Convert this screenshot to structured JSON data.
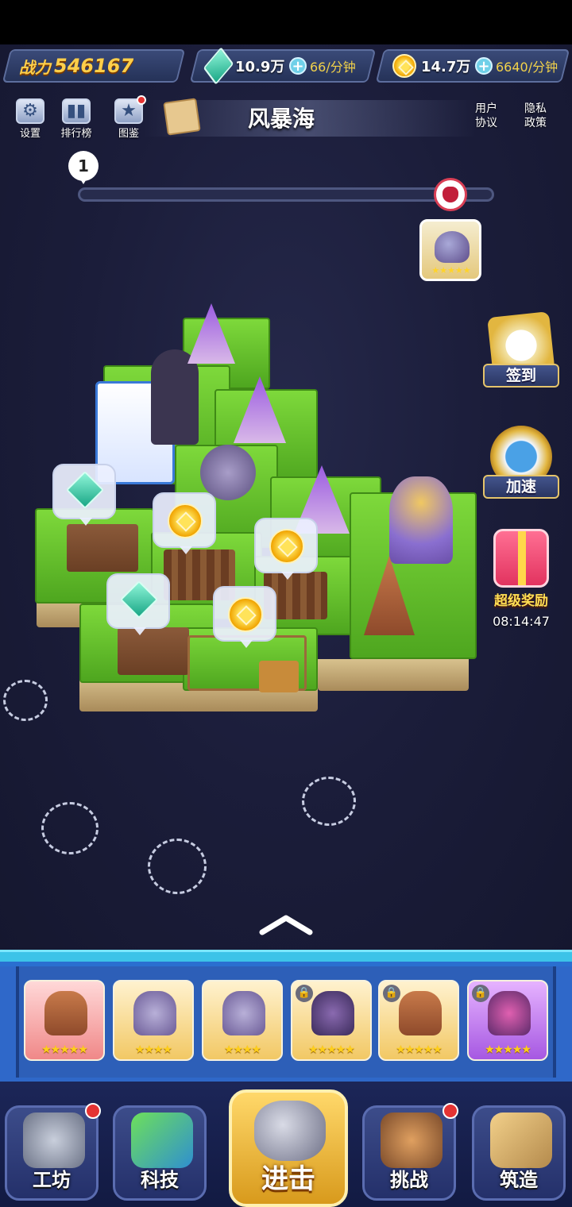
{
  "hud": {
    "power_label": "战力",
    "power_value": "546167",
    "gems": {
      "amount": "10.9万",
      "rate": "66/分钟",
      "icon": "gem-icon"
    },
    "gold": {
      "amount": "14.7万",
      "rate": "6640/分钟",
      "icon": "coin-icon"
    }
  },
  "toolbar": {
    "settings": "设置",
    "leaderboard": "排行榜",
    "codex": "图鉴",
    "area_name": "风暴海",
    "user_agreement": "用户\n协议",
    "privacy_policy": "隐私\n政策"
  },
  "progress": {
    "current_wave": "1",
    "fill_fraction": 0
  },
  "boss_card": {
    "stars": "★★★★★"
  },
  "side": {
    "signin": "签到",
    "speedup": "加速",
    "super_reward": "超级奖励",
    "timer": "08:14:47"
  },
  "units": [
    {
      "style": "red",
      "locked": false,
      "stars": "★★★★★"
    },
    {
      "style": "gold",
      "locked": false,
      "stars": "★★★★"
    },
    {
      "style": "gold",
      "locked": false,
      "stars": "★★★★"
    },
    {
      "style": "gold",
      "locked": true,
      "stars": "★★★★★"
    },
    {
      "style": "gold",
      "locked": true,
      "stars": "★★★★★"
    },
    {
      "style": "purple",
      "locked": true,
      "stars": "★★★★★"
    }
  ],
  "nav": {
    "workshop": "工坊",
    "tech": "科技",
    "attack": "进击",
    "challenge": "挑战",
    "build": "筑造"
  },
  "colors": {
    "sea": "#1b1d3a",
    "gold_text": "#ffcf4a",
    "panel_blue": "#2f68c9",
    "grass": "#6cc62f"
  }
}
